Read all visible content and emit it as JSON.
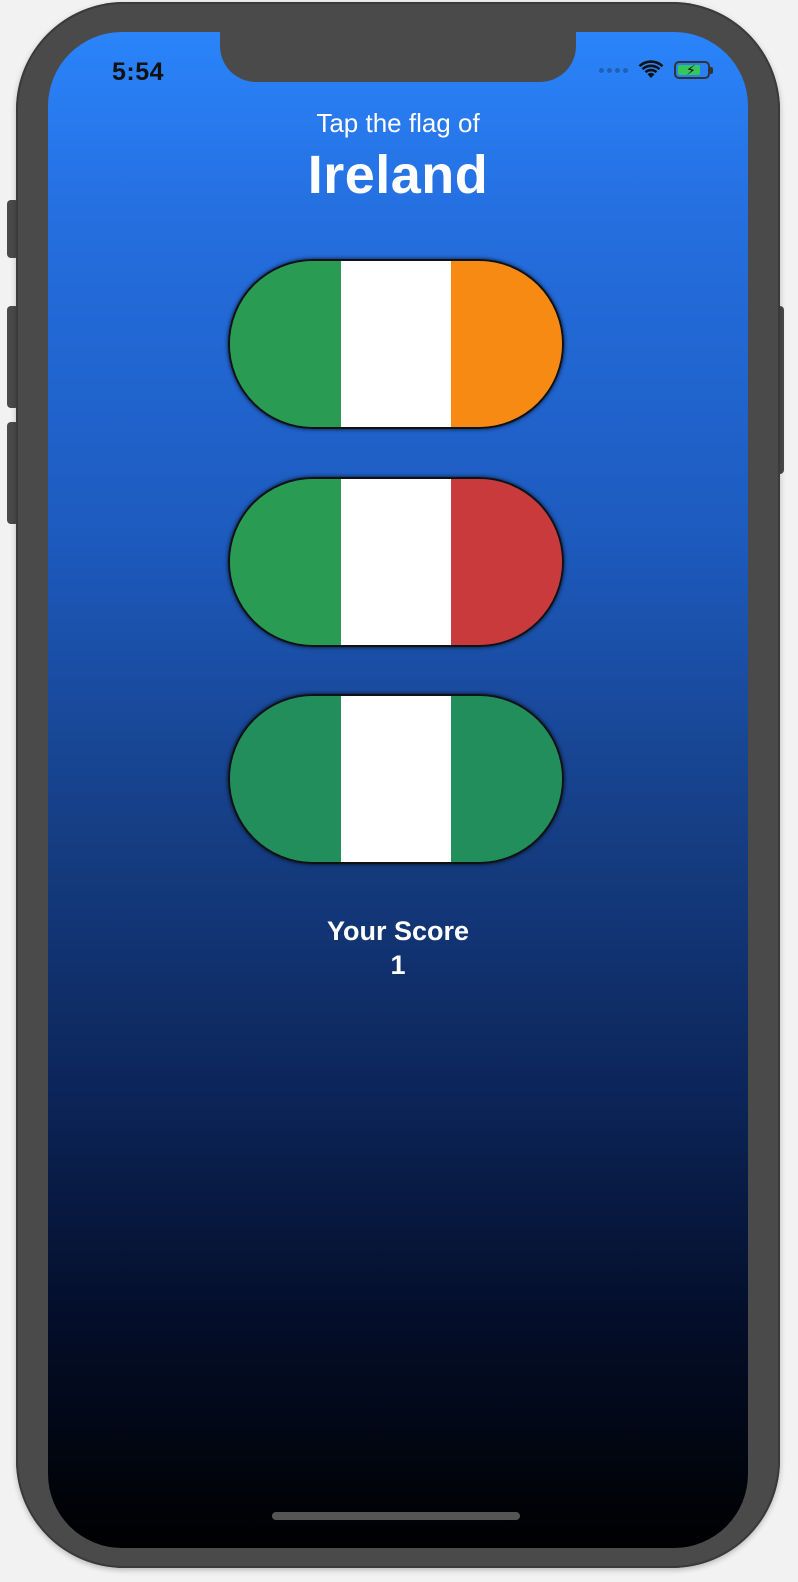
{
  "status_bar": {
    "time": "5:54",
    "icons": [
      "signal-dots-icon",
      "wifi-icon",
      "battery-charging-icon"
    ]
  },
  "question": {
    "prompt": "Tap the flag of",
    "country": "Ireland"
  },
  "flags": [
    {
      "name": "flag-option-1",
      "colors": [
        "#2a9b53",
        "#ffffff",
        "#f78a12"
      ]
    },
    {
      "name": "flag-option-2",
      "colors": [
        "#2a9b53",
        "#ffffff",
        "#c93a3c"
      ]
    },
    {
      "name": "flag-option-3",
      "colors": [
        "#228e5c",
        "#ffffff",
        "#228e5c"
      ]
    }
  ],
  "score": {
    "label": "Your Score",
    "value": "1"
  },
  "colors": {
    "background_top": "#2a84fa",
    "background_bottom": "#000000",
    "text": "#ffffff"
  }
}
